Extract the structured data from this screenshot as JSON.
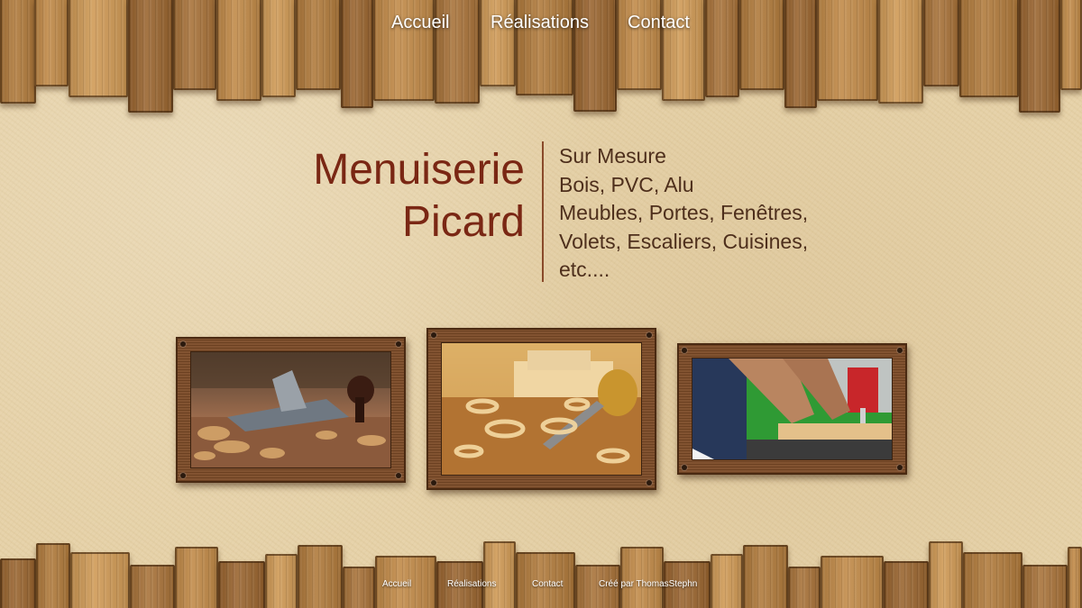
{
  "nav": {
    "home": "Accueil",
    "work": "Réalisations",
    "contact": "Contact"
  },
  "brand": {
    "line1": "Menuiserie",
    "line2": "Picard"
  },
  "services": [
    "Sur Mesure",
    "Bois, PVC, Alu",
    "Meubles, Portes, Fenêtres,",
    "Volets, Escaliers, Cuisines,",
    "etc...."
  ],
  "gallery": [
    {
      "icon": "woodworking-plane-photo"
    },
    {
      "icon": "wood-carving-tool-photo"
    },
    {
      "icon": "carpenter-bandsaw-photo"
    }
  ],
  "footer": {
    "home": "Accueil",
    "work": "Réalisations",
    "contact": "Contact",
    "credit": "Créé par ThomasStephn"
  },
  "colors": {
    "brand_text": "#7a2714",
    "services_text": "#4e2f1c",
    "paper_background": "#e6d2a8",
    "divider": "#8a4a2a"
  }
}
